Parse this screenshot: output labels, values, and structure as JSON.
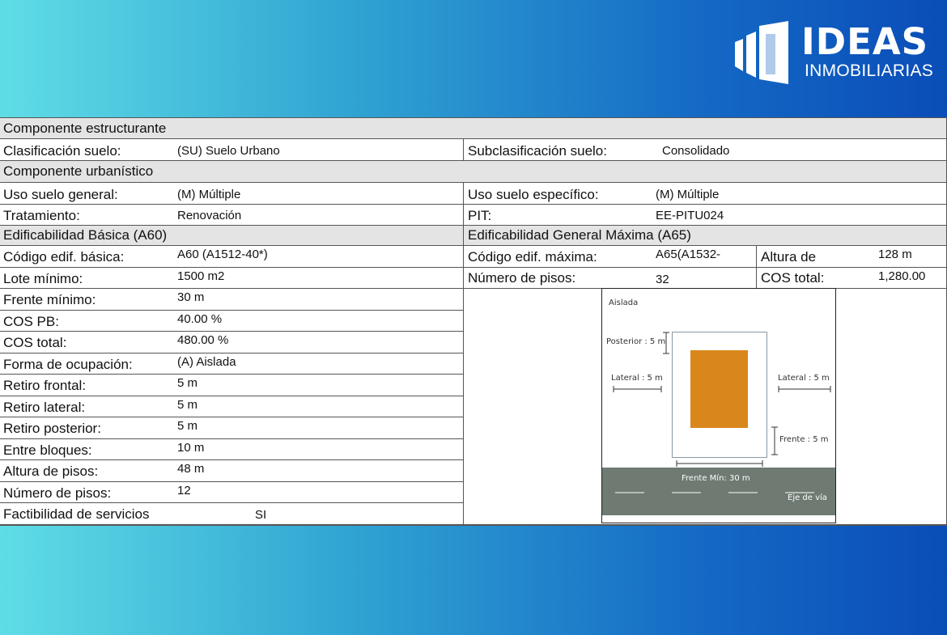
{
  "brand": {
    "name": "IDEAS",
    "subtitle": "INMOBILIARIAS"
  },
  "sections": {
    "estructurante": "Componente  estructurante",
    "urbanistico": "Componente  urbanístico",
    "basica": "Edificabilidad Básica (A60)",
    "maxima": "Edificabilidad General Máxima (A65)"
  },
  "fields": {
    "clasificacion": {
      "label": "Clasificación suelo:",
      "value": "(SU) Suelo Urbano"
    },
    "subclasificacion": {
      "label": "Subclasificación suelo:",
      "value": "Consolidado"
    },
    "uso_general": {
      "label": "Uso suelo general:",
      "value": "(M) Múltiple"
    },
    "uso_especifico": {
      "label": "Uso suelo específico:",
      "value": "(M) Múltiple"
    },
    "tratamiento": {
      "label": "Tratamiento:",
      "value": "Renovación"
    },
    "pit": {
      "label": "PIT:",
      "value": "EE-PITU024"
    },
    "codigo_basica": {
      "label": "Código edif. básica:",
      "value": "A60 (A1512-40*)"
    },
    "codigo_maxima": {
      "label": "Código edif. máxima:",
      "value": "A65(A1532-"
    },
    "altura_max": {
      "label": "Altura de",
      "value": "128 m"
    },
    "lote_minimo": {
      "label": "Lote mínimo:",
      "value": "1500 m2"
    },
    "pisos_max": {
      "label": "Número de pisos:",
      "value": "32"
    },
    "cos_total_max": {
      "label": "COS total:",
      "value": "1,280.00"
    }
  },
  "basic_rows": [
    {
      "label": "Frente mínimo:",
      "value": "30 m"
    },
    {
      "label": "COS PB:",
      "value": "40.00 %"
    },
    {
      "label": "COS total:",
      "value": "480.00 %"
    },
    {
      "label": "Forma de ocupación:",
      "value": "(A) Aislada"
    },
    {
      "label": "Retiro frontal:",
      "value": "5 m"
    },
    {
      "label": "Retiro lateral:",
      "value": "5 m"
    },
    {
      "label": "Retiro posterior:",
      "value": "5 m"
    },
    {
      "label": "Entre bloques:",
      "value": "10 m"
    },
    {
      "label": "Altura de pisos:",
      "value": "48 m"
    },
    {
      "label": "Número de pisos:",
      "value": "12"
    },
    {
      "label": "Factibilidad de servicios",
      "value": "SI"
    }
  ],
  "diagram": {
    "title": "Aislada",
    "posterior": "Posterior : 5 m",
    "lateral_left": "Lateral : 5 m",
    "lateral_right": "Lateral : 5 m",
    "frente": "Frente : 5 m",
    "frente_min": "Frente Mín: 30 m",
    "eje": "Eje de vía",
    "colors": {
      "building": "#d9861a",
      "road": "#6e7a72"
    }
  }
}
